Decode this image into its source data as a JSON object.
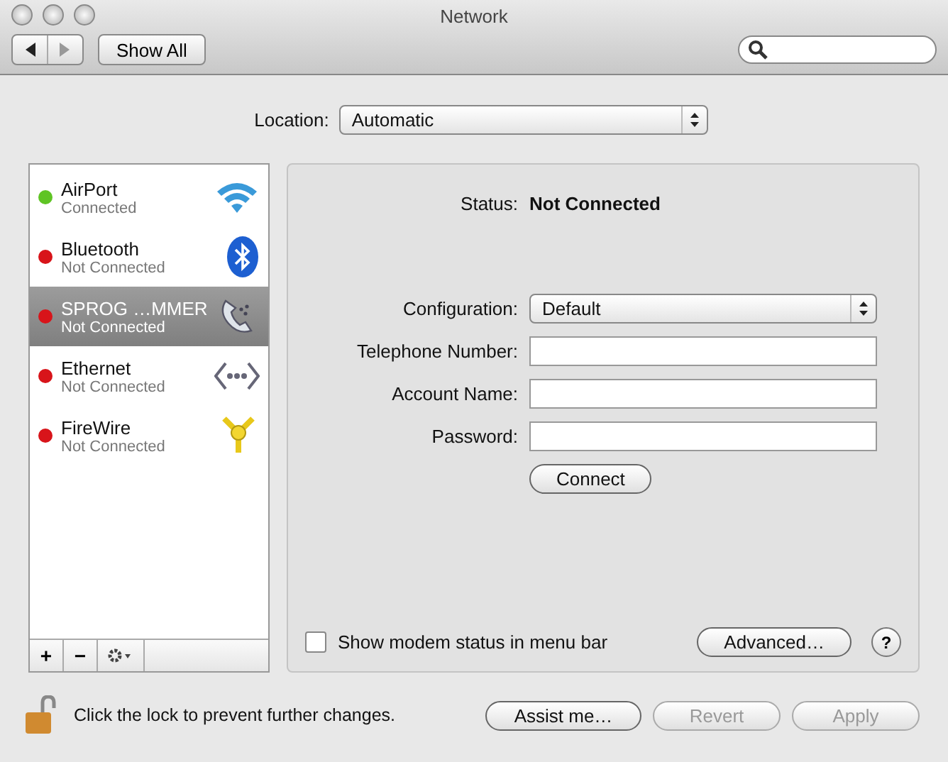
{
  "window": {
    "title": "Network"
  },
  "toolbar": {
    "show_all": "Show All"
  },
  "location": {
    "label": "Location:",
    "value": "Automatic"
  },
  "services": [
    {
      "name": "AirPort",
      "status": "Connected",
      "color": "#5fc424",
      "kind": "wifi",
      "selected": false
    },
    {
      "name": "Bluetooth",
      "status": "Not Connected",
      "color": "#d8141a",
      "kind": "bluetooth",
      "selected": false
    },
    {
      "name": "SPROG …MMER",
      "status": "Not Connected",
      "color": "#d8141a",
      "kind": "phone",
      "selected": true
    },
    {
      "name": "Ethernet",
      "status": "Not Connected",
      "color": "#d8141a",
      "kind": "ethernet",
      "selected": false
    },
    {
      "name": "FireWire",
      "status": "Not Connected",
      "color": "#d8141a",
      "kind": "firewire",
      "selected": false
    }
  ],
  "list_buttons": [
    "+",
    "−"
  ],
  "status": {
    "label": "Status:",
    "value": "Not Connected"
  },
  "fields": [
    {
      "label": "Configuration:",
      "kind": "select",
      "value": "Default"
    },
    {
      "label": "Telephone Number:",
      "kind": "text"
    },
    {
      "label": "Account Name:",
      "kind": "text"
    },
    {
      "label": "Password:",
      "kind": "text"
    }
  ],
  "connect": "Connect",
  "modem_checkbox": {
    "label": "Show modem status in menu bar",
    "checked": false
  },
  "advanced": "Advanced…",
  "help": "?",
  "lock_text": "Click the lock to prevent further changes.",
  "buttons": [
    {
      "label": "Assist me…",
      "disabled": false
    },
    {
      "label": "Revert",
      "disabled": true
    },
    {
      "label": "Apply",
      "disabled": true
    }
  ]
}
